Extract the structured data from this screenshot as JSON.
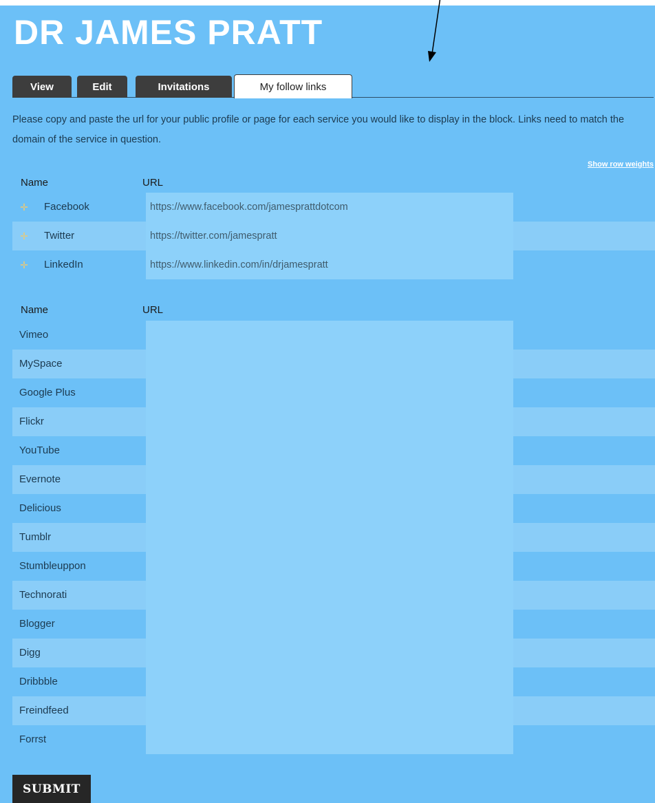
{
  "page_title": "DR JAMES PRATT",
  "tabs": [
    {
      "label": "View",
      "active": false
    },
    {
      "label": "Edit",
      "active": false
    },
    {
      "label": "Invitations",
      "active": false
    },
    {
      "label": "My follow links",
      "active": true
    }
  ],
  "intro": "Please copy and paste the url for your public profile or page for each service you would like to display in the block. Links need to match the domain of the service in question.",
  "show_row_weights": "Show row weights",
  "enabled_table": {
    "header_name": "Name",
    "header_url": "URL",
    "rows": [
      {
        "name": "Facebook",
        "url": "https://www.facebook.com/jamesprattdotcom"
      },
      {
        "name": "Twitter",
        "url": "https://twitter.com/jamespratt"
      },
      {
        "name": "LinkedIn",
        "url": "https://www.linkedin.com/in/drjamespratt"
      }
    ]
  },
  "disabled_table": {
    "header_name": "Name",
    "header_url": "URL",
    "rows": [
      {
        "name": "Vimeo",
        "url": ""
      },
      {
        "name": "MySpace",
        "url": ""
      },
      {
        "name": "Google Plus",
        "url": ""
      },
      {
        "name": "Flickr",
        "url": ""
      },
      {
        "name": "YouTube",
        "url": ""
      },
      {
        "name": "Evernote",
        "url": ""
      },
      {
        "name": "Delicious",
        "url": ""
      },
      {
        "name": "Tumblr",
        "url": ""
      },
      {
        "name": "Stumbleuppon",
        "url": ""
      },
      {
        "name": "Technorati",
        "url": ""
      },
      {
        "name": "Blogger",
        "url": ""
      },
      {
        "name": "Digg",
        "url": ""
      },
      {
        "name": "Dribbble",
        "url": ""
      },
      {
        "name": "Freindfeed",
        "url": ""
      },
      {
        "name": "Forrst",
        "url": ""
      }
    ]
  },
  "submit_label": "SUBMIT",
  "icons": {
    "drag_handle": "drag-handle-icon",
    "annotation": "arrow-icon"
  },
  "colors": {
    "background": "#6cc0f7",
    "stripe": "#8acdf8",
    "url_box": "#8dd1fa",
    "tab_dark": "#3d3d3d",
    "tab_active": "#ffffff",
    "button": "#262626",
    "drag_handle": "#e9c978",
    "title": "#ffffff"
  }
}
